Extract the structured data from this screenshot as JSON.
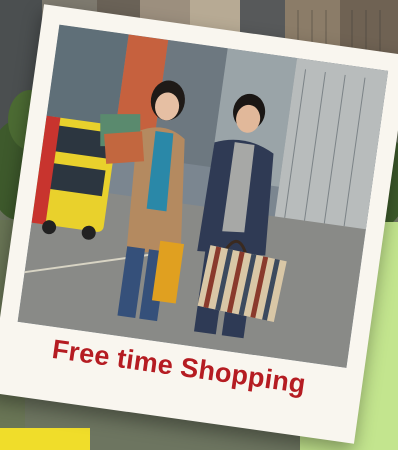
{
  "caption": "Free time Shopping",
  "colors": {
    "caption": "#b51c22",
    "polaroid_frame": "#f9f6ef",
    "accent_green": "#c3e58e",
    "accent_yellow": "#f0dd2a",
    "bus": "#e9d12c"
  },
  "icons": [
    "shopping-bag-icon"
  ]
}
